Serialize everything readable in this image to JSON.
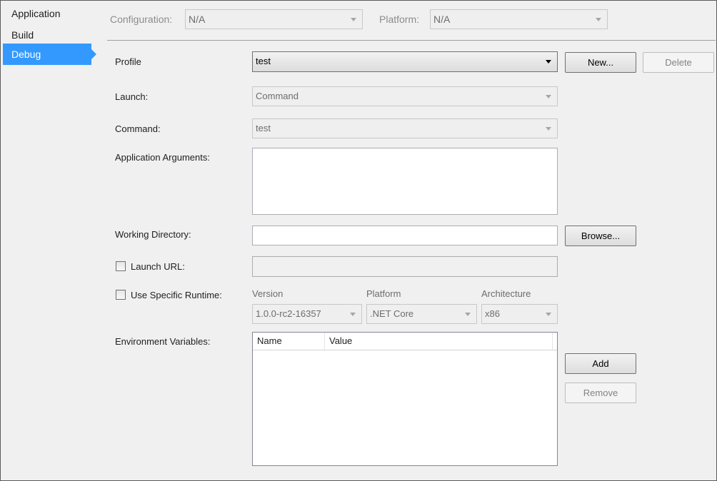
{
  "nav": {
    "items": [
      "Application",
      "Build",
      "Debug"
    ]
  },
  "top": {
    "config_label": "Configuration:",
    "config_value": "N/A",
    "platform_label": "Platform:",
    "platform_value": "N/A"
  },
  "profile": {
    "label": "Profile",
    "value": "test",
    "new_label": "New...",
    "delete_label": "Delete"
  },
  "launch": {
    "label": "Launch:",
    "value": "Command"
  },
  "command": {
    "label": "Command:",
    "value": "test"
  },
  "app_args": {
    "label": "Application Arguments:",
    "value": ""
  },
  "working_dir": {
    "label": "Working Directory:",
    "value": "",
    "browse_label": "Browse..."
  },
  "launch_url": {
    "label": "Launch URL:",
    "checked": false,
    "value": ""
  },
  "runtime": {
    "label": "Use Specific Runtime:",
    "checked": false,
    "version_label": "Version",
    "version_value": "1.0.0-rc2-16357",
    "platform_label": "Platform",
    "platform_value": ".NET Core",
    "arch_label": "Architecture",
    "arch_value": "x86"
  },
  "env": {
    "label": "Environment Variables:",
    "columns": [
      "Name",
      "Value"
    ],
    "rows": [],
    "add_label": "Add",
    "remove_label": "Remove"
  }
}
